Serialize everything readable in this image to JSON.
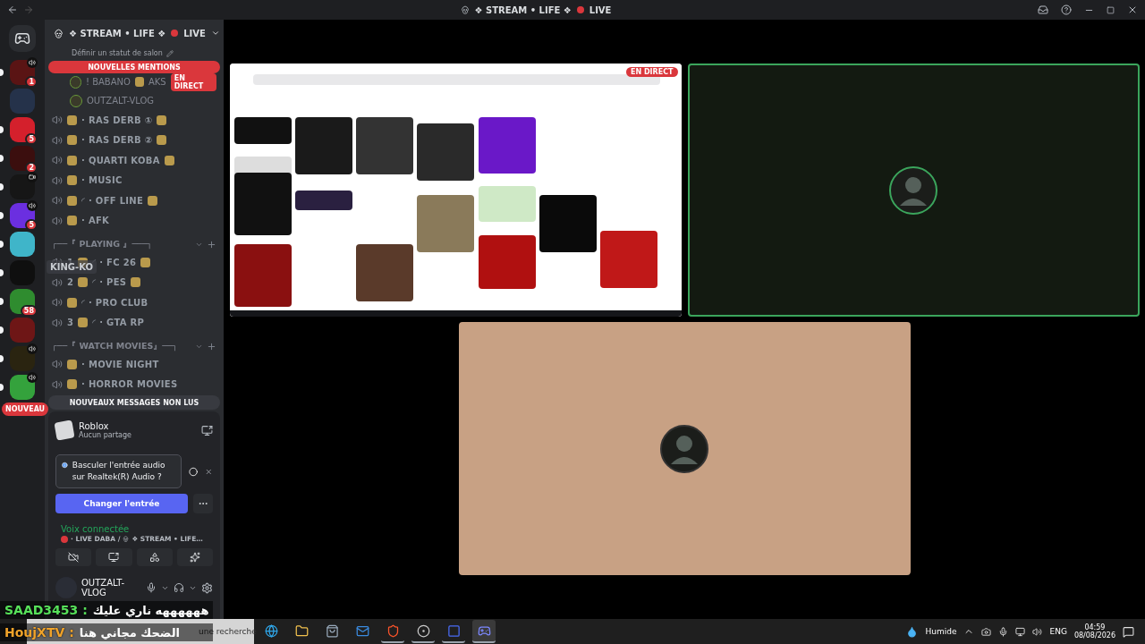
{
  "window": {
    "title": "❖ STREAM • LIFE ❖",
    "title_suffix": "LIVE"
  },
  "server_rail": {
    "servers": [
      {
        "color": "#5a1414",
        "badge": "1",
        "speaker": true,
        "video": false,
        "unread": true
      },
      {
        "color": "#25324a",
        "speaker": false,
        "video": false,
        "unread": false
      },
      {
        "color": "#d4202c",
        "badge": "5",
        "speaker": false,
        "video": false,
        "unread": true
      },
      {
        "color": "#3b0e0e",
        "badge": "2",
        "speaker": false,
        "video": false,
        "unread": true
      },
      {
        "color": "#161616",
        "speaker": false,
        "video": true,
        "unread": true
      },
      {
        "color": "#6b2fe0",
        "badge": "5",
        "speaker": true,
        "video": false,
        "unread": true
      },
      {
        "color": "#3fb5c9",
        "speaker": false,
        "video": false,
        "unread": true
      },
      {
        "color": "#0f0f0f",
        "speaker": false,
        "video": false,
        "unread": true
      },
      {
        "color": "#2f8c2f",
        "badge": "58",
        "speaker": false,
        "video": false,
        "unread": true
      },
      {
        "color": "#6e1616",
        "speaker": false,
        "video": false,
        "unread": true
      },
      {
        "color": "#2a2410",
        "speaker": true,
        "video": false,
        "unread": true
      },
      {
        "color": "#34a23c",
        "speaker": true,
        "video": false,
        "unread": true
      }
    ],
    "hover_label": "KING-KO",
    "new_pill": "NOUVEAU"
  },
  "sidebar": {
    "title": "❖ STREAM • LIFE ❖",
    "title_suffix": "LIVE",
    "status_hint": "Définir un statut de salon",
    "mentions_pill": "NOUVELLES MENTIONS",
    "voice_users": [
      {
        "name": "! BABANO",
        "tag": "AKS",
        "live": "EN DIRECT"
      },
      {
        "name": "OUTZALT-VLOG"
      }
    ],
    "groups": [
      {
        "channels": [
          {
            "name": "· RAS DERB ①",
            "trailing_emoji": true
          },
          {
            "name": "· RAS DERB ②",
            "trailing_emoji": true
          },
          {
            "name": "· QUARTI KOBA",
            "trailing_emoji": true
          },
          {
            "name": "· MUSIC",
            "trailing_emoji": false
          },
          {
            "name": "◜ · OFF LINE",
            "trailing_emoji": true
          },
          {
            "name": "· AFK",
            "trailing_emoji": false
          }
        ]
      },
      {
        "category": "┌──『 PLAYING 』───┐",
        "channels": [
          {
            "prefix": "1",
            "name": "◜ · FC 26",
            "trailing_emoji": true
          },
          {
            "prefix": "2",
            "name": "◜ · PES",
            "trailing_emoji": true
          },
          {
            "name": "◜ · PRO CLUB",
            "trailing_emoji": false
          },
          {
            "prefix": "3",
            "name": "◜ · GTA RP",
            "trailing_emoji": false
          }
        ]
      },
      {
        "category": "┌──『 WATCH MOVIES』──┐",
        "channels": [
          {
            "name": "· MOVIE NIGHT",
            "trailing_emoji": false
          },
          {
            "name": "· HORROR MOVIES",
            "trailing_emoji": false
          }
        ]
      }
    ],
    "unread_pill": "NOUVEAUX MESSAGES NON LUS",
    "activity": {
      "name": "Roblox",
      "status": "Aucun partage"
    },
    "notice": {
      "text": "Basculer l'entrée audio sur Realtek(R) Audio ?",
      "action": "Changer l'entrée"
    },
    "voice": {
      "status": "Voix connectée",
      "channel": "· LIVE DABA /",
      "server": "❖ STREAM • LIFE…"
    },
    "user": {
      "name": "OUTZALT-VLOG"
    }
  },
  "tiles": [
    {
      "kind": "stream",
      "live_badge": "EN DIRECT",
      "speaking": false,
      "color": "#ffffff"
    },
    {
      "kind": "avatar",
      "speaking": true,
      "color": "#131a11"
    },
    {
      "kind": "avatar",
      "speaking": false,
      "color": "#c8a184"
    }
  ],
  "chat_overlay": [
    {
      "user": "SAAD3453 :",
      "text": "ههههههه ناري عليك",
      "color": "#57e15a"
    },
    {
      "user": "HoujXTV :",
      "text": "الضحك مجاني هنا",
      "color": "#f0a32a"
    }
  ],
  "taskbar": {
    "search": "une recherche",
    "apps": [
      {
        "running": false,
        "selected": false
      },
      {
        "running": false,
        "selected": false
      },
      {
        "running": false,
        "selected": false
      },
      {
        "running": false,
        "selected": false
      },
      {
        "running": true,
        "selected": false
      },
      {
        "running": true,
        "selected": false
      },
      {
        "running": true,
        "selected": false
      },
      {
        "running": true,
        "selected": true
      }
    ],
    "weather": "Humide",
    "language": "ENG",
    "time": "04:59",
    "date": "08/08/2026"
  }
}
